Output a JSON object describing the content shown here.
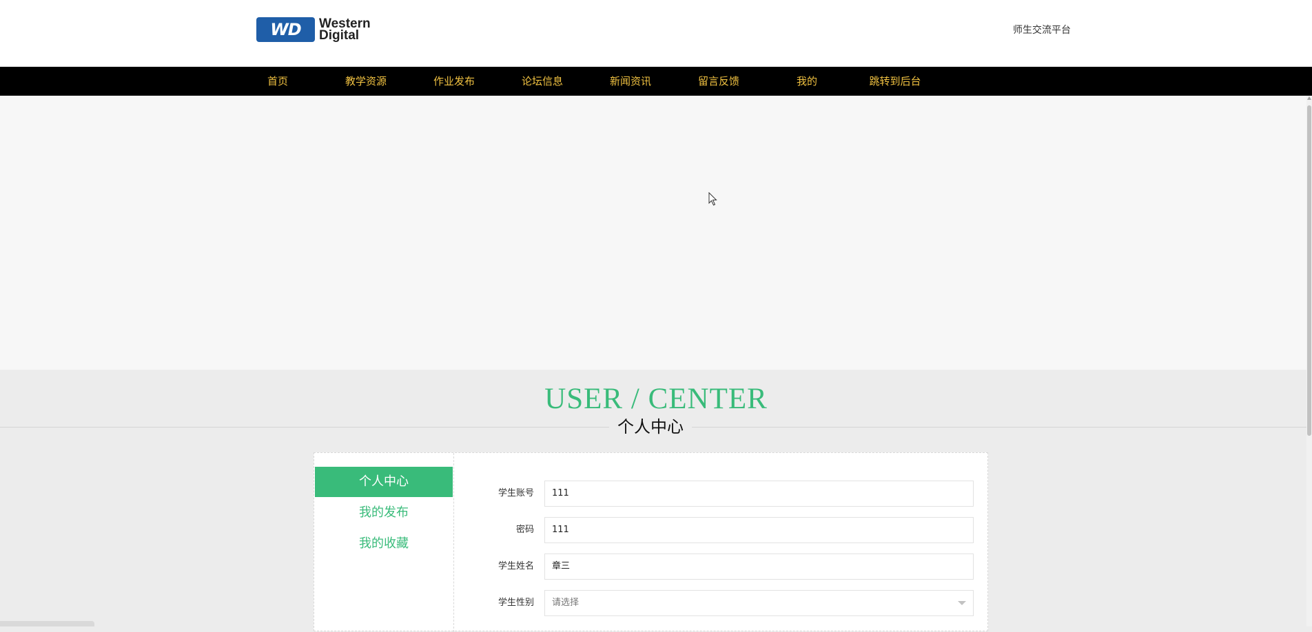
{
  "header": {
    "logo_line1": "Western",
    "logo_line2": "Digital",
    "logo_badge": "WD",
    "platform_name": "师生交流平台"
  },
  "nav": {
    "items": [
      "首页",
      "教学资源",
      "作业发布",
      "论坛信息",
      "新闻资讯",
      "留言反馈",
      "我的",
      "跳转到后台"
    ]
  },
  "section": {
    "title_en": "USER / CENTER",
    "title_cn": "个人中心"
  },
  "sidebar": {
    "items": [
      "个人中心",
      "我的发布",
      "我的收藏"
    ],
    "active_index": 0
  },
  "form": {
    "fields": [
      {
        "label": "学生账号",
        "value": "111"
      },
      {
        "label": "密码",
        "value": "111"
      },
      {
        "label": "学生姓名",
        "value": "章三"
      },
      {
        "label": "学生性别",
        "placeholder": "请选择"
      }
    ]
  },
  "colors": {
    "accent": "#39bb7a",
    "nav_text": "#f0c141",
    "nav_bg": "#000000",
    "logo_blue": "#1f5ea8"
  }
}
